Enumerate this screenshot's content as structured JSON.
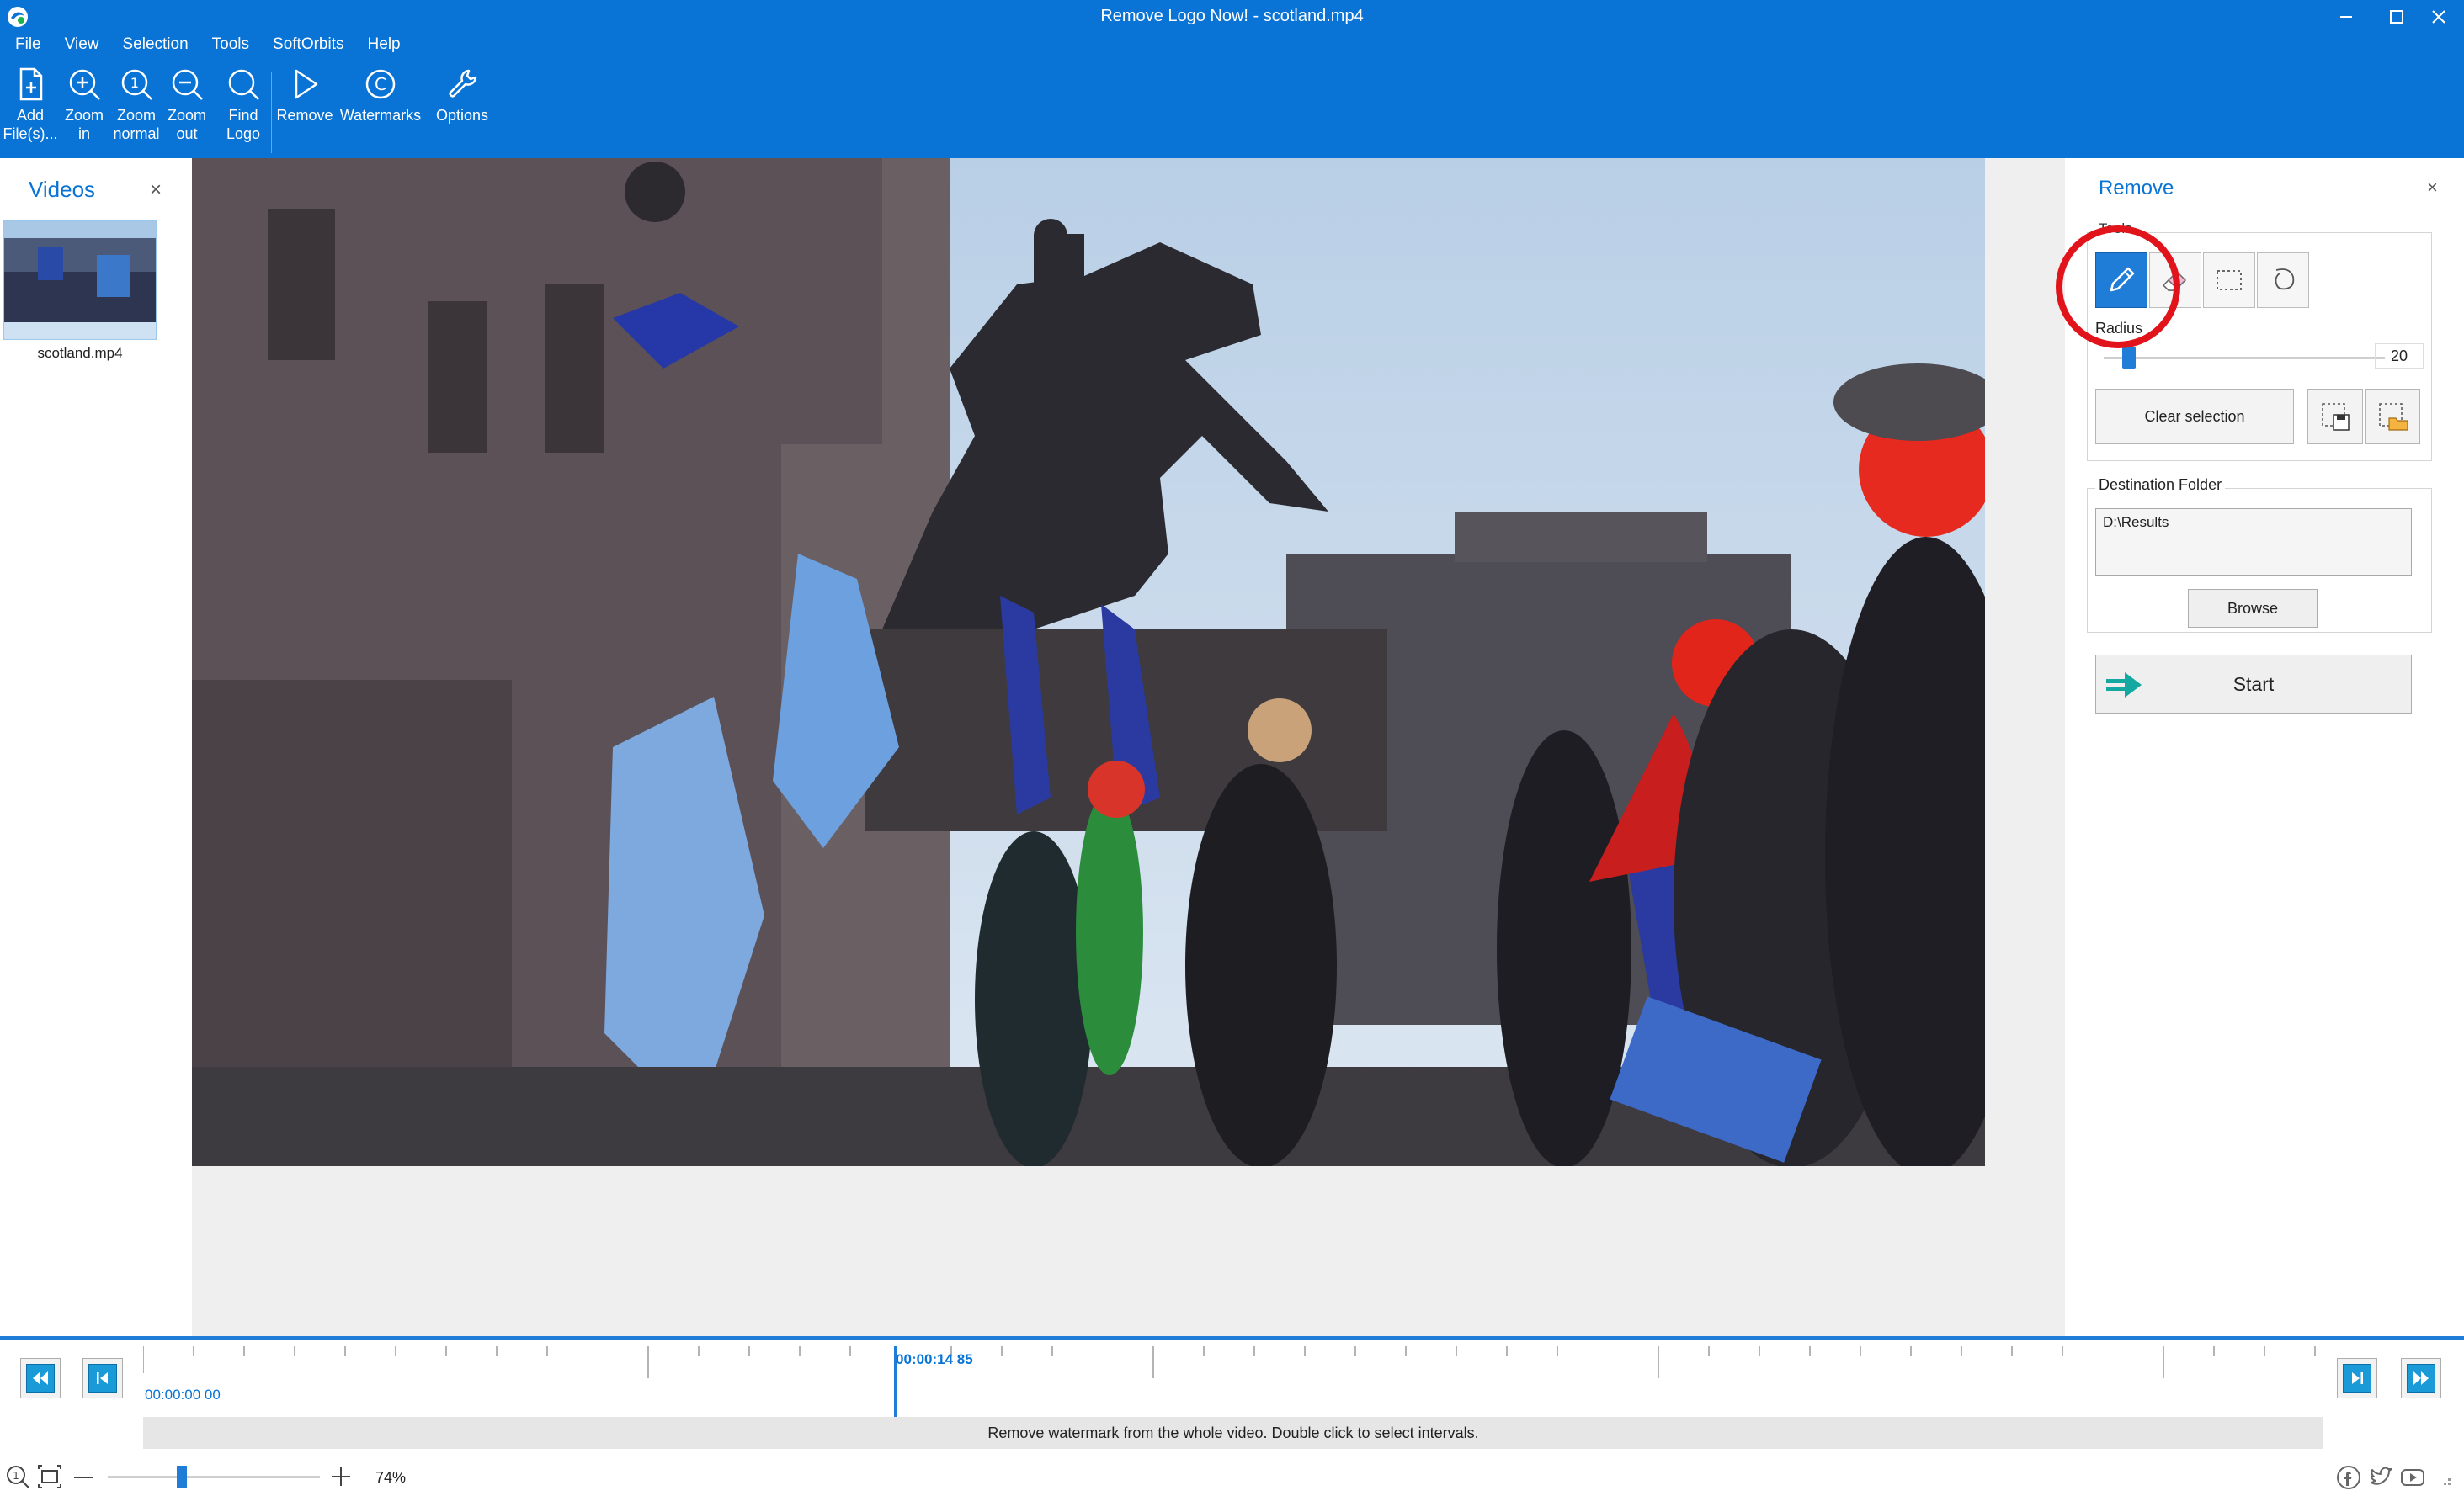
{
  "window": {
    "title": "Remove Logo Now! - scotland.mp4"
  },
  "menu": {
    "items": [
      {
        "u": "F",
        "rest": "ile"
      },
      {
        "u": "V",
        "rest": "iew"
      },
      {
        "u": "S",
        "rest": "election"
      },
      {
        "u": "T",
        "rest": "ools"
      },
      {
        "u": "",
        "rest": "SoftOrbits"
      },
      {
        "u": "H",
        "rest": "elp"
      }
    ]
  },
  "ribbon": {
    "add": [
      "Add",
      "File(s)..."
    ],
    "zoom_in": [
      "Zoom",
      "in"
    ],
    "zoom_normal": [
      "Zoom",
      "normal"
    ],
    "zoom_out": [
      "Zoom",
      "out"
    ],
    "find_logo": [
      "Find",
      "Logo"
    ],
    "remove": "Remove",
    "watermarks": "Watermarks",
    "options": "Options"
  },
  "left_panel": {
    "title": "Videos",
    "close": "×",
    "file_name": "scotland.mp4"
  },
  "right_panel": {
    "title": "Remove",
    "close": "×",
    "tools_label": "Tools",
    "radius_label": "Radius",
    "radius_value": "20",
    "clear_selection": "Clear selection",
    "destination_label": "Destination Folder",
    "destination_value": "D:\\Results",
    "browse": "Browse",
    "start": "Start"
  },
  "timeline": {
    "start_time": "00:00:00 00",
    "current_time": "00:00:14 85",
    "hint": "Remove watermark from the whole video. Double click to select intervals."
  },
  "statusbar": {
    "zoom": "74%"
  },
  "colors": {
    "accent": "#0a74d6",
    "highlight": "#e2141b",
    "active_tool": "#1f7dd8"
  }
}
